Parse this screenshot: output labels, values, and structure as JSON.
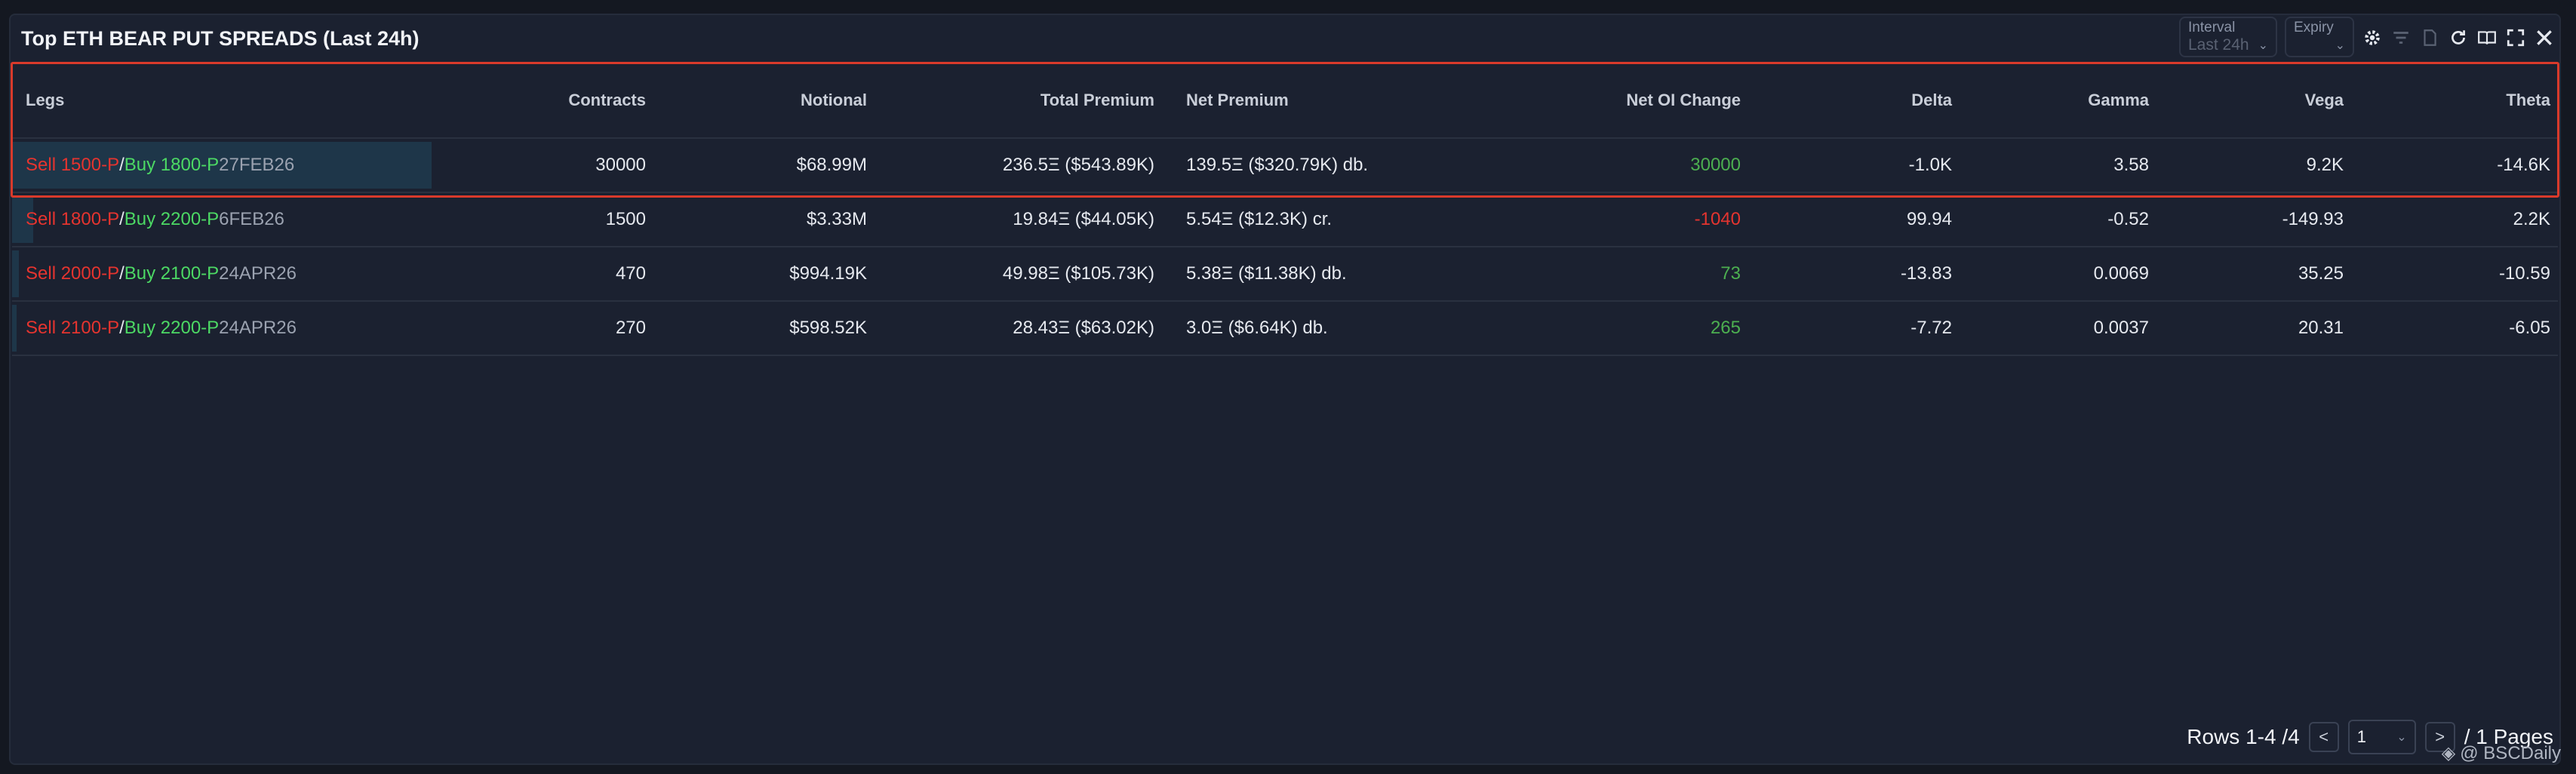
{
  "panel": {
    "title": "Top ETH BEAR PUT SPREADS (Last 24h)"
  },
  "toolbar": {
    "interval_label": "Interval",
    "interval_value": "Last 24h",
    "expiry_label": "Expiry",
    "expiry_value": ""
  },
  "table": {
    "columns": [
      "Legs",
      "Contracts",
      "Notional",
      "Total Premium",
      "Net Premium",
      "Net OI Change",
      "Delta",
      "Gamma",
      "Vega",
      "Theta"
    ],
    "rows": [
      {
        "sell": "Sell 1500-P",
        "sep": " / ",
        "buy": "Buy 1800-P",
        "expiry": " 27FEB26",
        "contracts": "30000",
        "notional": "$68.99M",
        "total_premium": "236.5Ξ ($543.89K)",
        "net_premium": "139.5Ξ ($320.79K) db.",
        "net_oi": "30000",
        "delta": "-1.0K",
        "gamma": "3.58",
        "vega": "9.2K",
        "theta": "-14.6K",
        "share": 1.0
      },
      {
        "sell": "Sell 1800-P",
        "sep": " / ",
        "buy": "Buy 2200-P",
        "expiry": " 6FEB26",
        "contracts": "1500",
        "notional": "$3.33M",
        "total_premium": "19.84Ξ ($44.05K)",
        "net_premium": "5.54Ξ ($12.3K) cr.",
        "net_oi": "-1040",
        "delta": "99.94",
        "gamma": "-0.52",
        "vega": "-149.93",
        "theta": "2.2K",
        "share": 0.05
      },
      {
        "sell": "Sell 2000-P",
        "sep": " / ",
        "buy": "Buy 2100-P",
        "expiry": " 24APR26",
        "contracts": "470",
        "notional": "$994.19K",
        "total_premium": "49.98Ξ ($105.73K)",
        "net_premium": "5.38Ξ ($11.38K) db.",
        "net_oi": "73",
        "delta": "-13.83",
        "gamma": "0.0069",
        "vega": "35.25",
        "theta": "-10.59",
        "share": 0.016
      },
      {
        "sell": "Sell 2100-P",
        "sep": " / ",
        "buy": "Buy 2200-P",
        "expiry": " 24APR26",
        "contracts": "270",
        "notional": "$598.52K",
        "total_premium": "28.43Ξ ($63.02K)",
        "net_premium": "3.0Ξ ($6.64K) db.",
        "net_oi": "265",
        "delta": "-7.72",
        "gamma": "0.0037",
        "vega": "20.31",
        "theta": "-6.05",
        "share": 0.009
      }
    ]
  },
  "footer": {
    "rows_text": "Rows 1-4 /4",
    "page_value": "1",
    "pages_text": "/ 1 Pages",
    "watermark": "@ BSCDaily"
  },
  "colors": {
    "sell": "#e5342f",
    "buy": "#4cd964",
    "highlight": "#d93a2b"
  },
  "icons": [
    "gear-icon",
    "filter-icon",
    "export-icon",
    "refresh-icon",
    "book-icon",
    "fullscreen-icon",
    "close-icon"
  ]
}
